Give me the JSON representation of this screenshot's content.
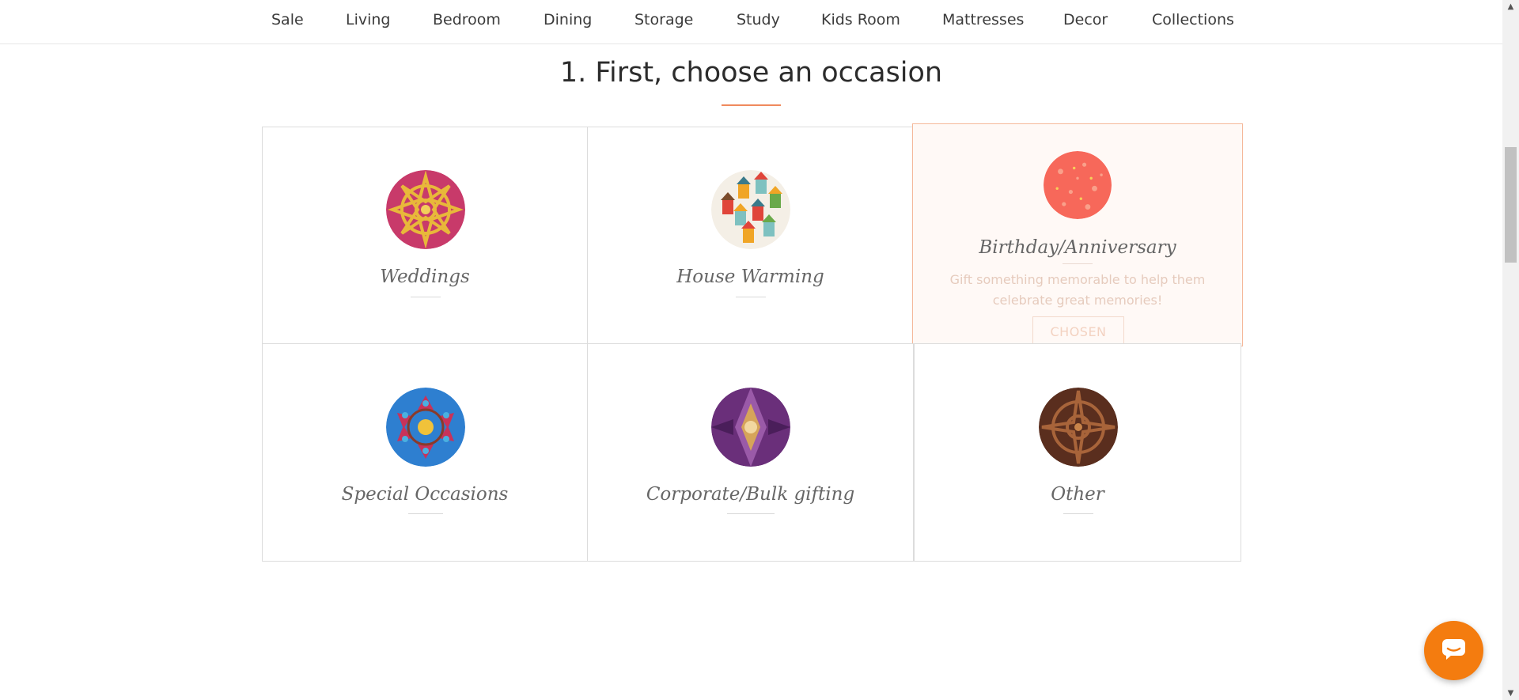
{
  "nav": {
    "items": [
      {
        "label": "Sale"
      },
      {
        "label": "Living"
      },
      {
        "label": "Bedroom"
      },
      {
        "label": "Dining"
      },
      {
        "label": "Storage"
      },
      {
        "label": "Study"
      },
      {
        "label": "Kids Room"
      },
      {
        "label": "Mattresses"
      },
      {
        "label": "Decor"
      },
      {
        "label": "Collections"
      }
    ]
  },
  "section": {
    "title": "1. First, choose an occasion",
    "accent_color": "#f08a5d"
  },
  "occasions": [
    {
      "label": "Weddings",
      "icon": "wedding-mandala-icon"
    },
    {
      "label": "House Warming",
      "icon": "birdhouses-icon"
    },
    {
      "label": "Birthday/Anniversary",
      "icon": "coral-pattern-icon",
      "description": "Gift something memorable to help them celebrate great memories!",
      "button_label": "CHOSEN",
      "selected": true
    },
    {
      "label": "Special Occasions",
      "icon": "kaleidoscope-blue-icon"
    },
    {
      "label": "Corporate/Bulk gifting",
      "icon": "kaleidoscope-purple-icon"
    },
    {
      "label": "Other",
      "icon": "kaleidoscope-brown-icon"
    }
  ],
  "chat": {
    "icon": "chat-bubble-icon",
    "color": "#f47c0f"
  }
}
